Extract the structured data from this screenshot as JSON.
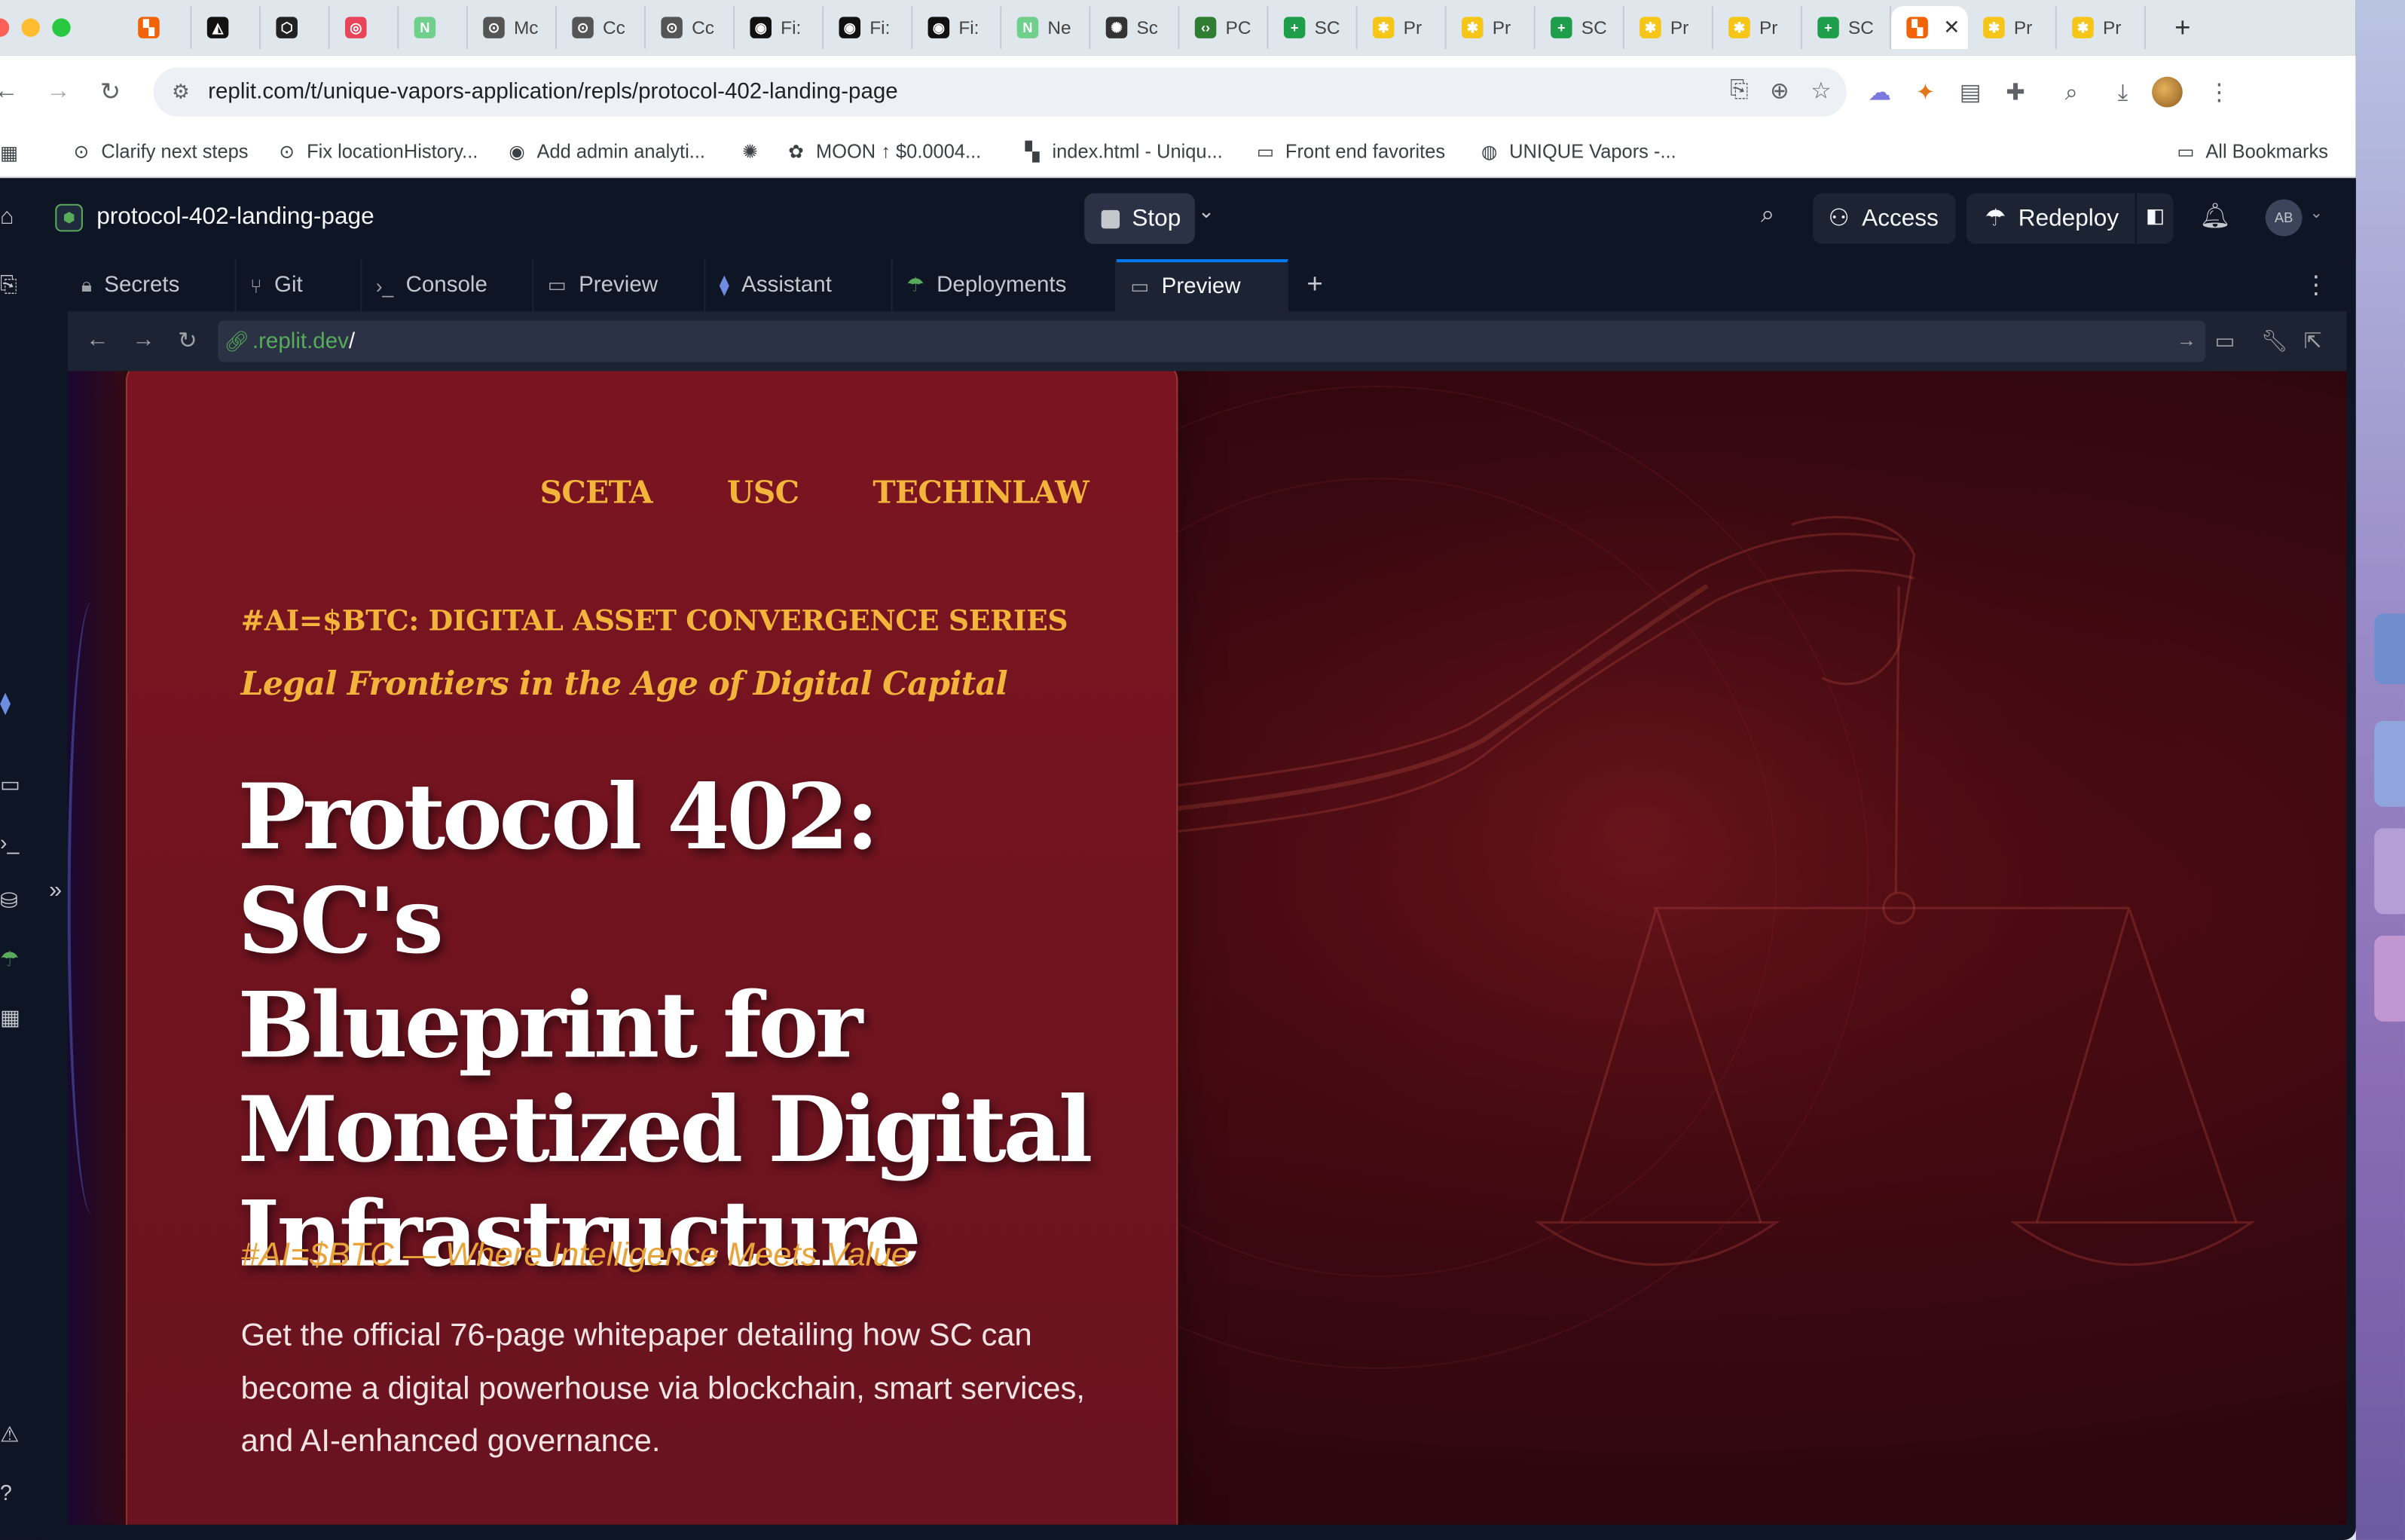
{
  "browser": {
    "tabs": [
      {
        "label": "",
        "fav_color": "#f26207",
        "fav_glyph": "▚"
      },
      {
        "label": "",
        "fav_color": "#111111",
        "fav_glyph": "◭"
      },
      {
        "label": "",
        "fav_color": "#222222",
        "fav_glyph": "⬡"
      },
      {
        "label": "",
        "fav_color": "#e8445a",
        "fav_glyph": "◎"
      },
      {
        "label": "",
        "fav_color": "#6fd08b",
        "fav_glyph": "N"
      },
      {
        "label": "Mc",
        "fav_color": "#555555",
        "fav_glyph": "⊙"
      },
      {
        "label": "Cc",
        "fav_color": "#555555",
        "fav_glyph": "⊙"
      },
      {
        "label": "Cc",
        "fav_color": "#555555",
        "fav_glyph": "⊙"
      },
      {
        "label": "Fi:",
        "fav_color": "#111111",
        "fav_glyph": "◉"
      },
      {
        "label": "Fi:",
        "fav_color": "#111111",
        "fav_glyph": "◉"
      },
      {
        "label": "Fi:",
        "fav_color": "#111111",
        "fav_glyph": "◉"
      },
      {
        "label": "Ne",
        "fav_color": "#6fd08b",
        "fav_glyph": "N"
      },
      {
        "label": "Sc",
        "fav_color": "#333333",
        "fav_glyph": "✺"
      },
      {
        "label": "PC",
        "fav_color": "#2e7d32",
        "fav_glyph": "‹›"
      },
      {
        "label": "SC",
        "fav_color": "#1e9e4a",
        "fav_glyph": "+"
      },
      {
        "label": "Pr",
        "fav_color": "#f5c518",
        "fav_glyph": "✱"
      },
      {
        "label": "Pr",
        "fav_color": "#f5c518",
        "fav_glyph": "✱"
      },
      {
        "label": "SC",
        "fav_color": "#1e9e4a",
        "fav_glyph": "+"
      },
      {
        "label": "Pr",
        "fav_color": "#f5c518",
        "fav_glyph": "✱"
      },
      {
        "label": "Pr",
        "fav_color": "#f5c518",
        "fav_glyph": "✱"
      },
      {
        "label": "SC",
        "fav_color": "#1e9e4a",
        "fav_glyph": "+"
      },
      {
        "label": "Pr",
        "fav_color": "#f5c518",
        "fav_glyph": "✱"
      },
      {
        "label": "Pr",
        "fav_color": "#f5c518",
        "fav_glyph": "✱"
      }
    ],
    "last_tab_label": "Pr",
    "url": "replit.com/t/unique-vapors-application/repls/protocol-402-landing-page",
    "bookmarks": [
      {
        "label": "Clarify next steps",
        "icon": "⊙"
      },
      {
        "label": "Fix locationHistory...",
        "icon": "⊙"
      },
      {
        "label": "Add admin analyti...",
        "icon": "◉"
      },
      {
        "label": "",
        "icon": "✺"
      },
      {
        "label": "MOON ↑ $0.0004...",
        "icon": "✿"
      },
      {
        "label": "index.html - Uniqu...",
        "icon": "▚"
      },
      {
        "label": "Front end favorites",
        "icon": "▭"
      },
      {
        "label": "UNIQUE Vapors -...",
        "icon": "◍"
      }
    ],
    "all_bookmarks": "All Bookmarks"
  },
  "replit": {
    "project_name": "protocol-402-landing-page",
    "stop_label": "Stop",
    "access_label": "Access",
    "redeploy_label": "Redeploy",
    "user_initials": "AB",
    "pane_tabs": [
      {
        "label": "Secrets",
        "icon": "lock-icon"
      },
      {
        "label": "Git",
        "icon": "git-icon"
      },
      {
        "label": "Console",
        "icon": "terminal-icon"
      },
      {
        "label": "Preview",
        "icon": "monitor-icon"
      },
      {
        "label": "Assistant",
        "icon": "assistant-icon"
      },
      {
        "label": "Deployments",
        "icon": "deploy-icon"
      },
      {
        "label": "Preview",
        "icon": "monitor-icon"
      }
    ],
    "preview_url_domain": ".replit.dev",
    "preview_url_path": "/"
  },
  "landing": {
    "nav": [
      "SCETA",
      "USC",
      "TECHINLAW"
    ],
    "series": "#AI=$BTC: DIGITAL ASSET CONVERGENCE SERIES",
    "subseries": "Legal Frontiers in the Age of Digital Capital",
    "hero_lines": [
      "Protocol 402: SC's",
      "Blueprint for",
      "Monetized Digital",
      "Infrastructure"
    ],
    "tagline": "#AI=$BTC — Where Intelligence Meets Value",
    "body": "Get the official 76-page whitepaper detailing how SC can become a digital powerhouse via blockchain, smart services, and AI-enhanced governance.",
    "accent_color": "#f2b43a",
    "card_color": "#7b1420"
  }
}
